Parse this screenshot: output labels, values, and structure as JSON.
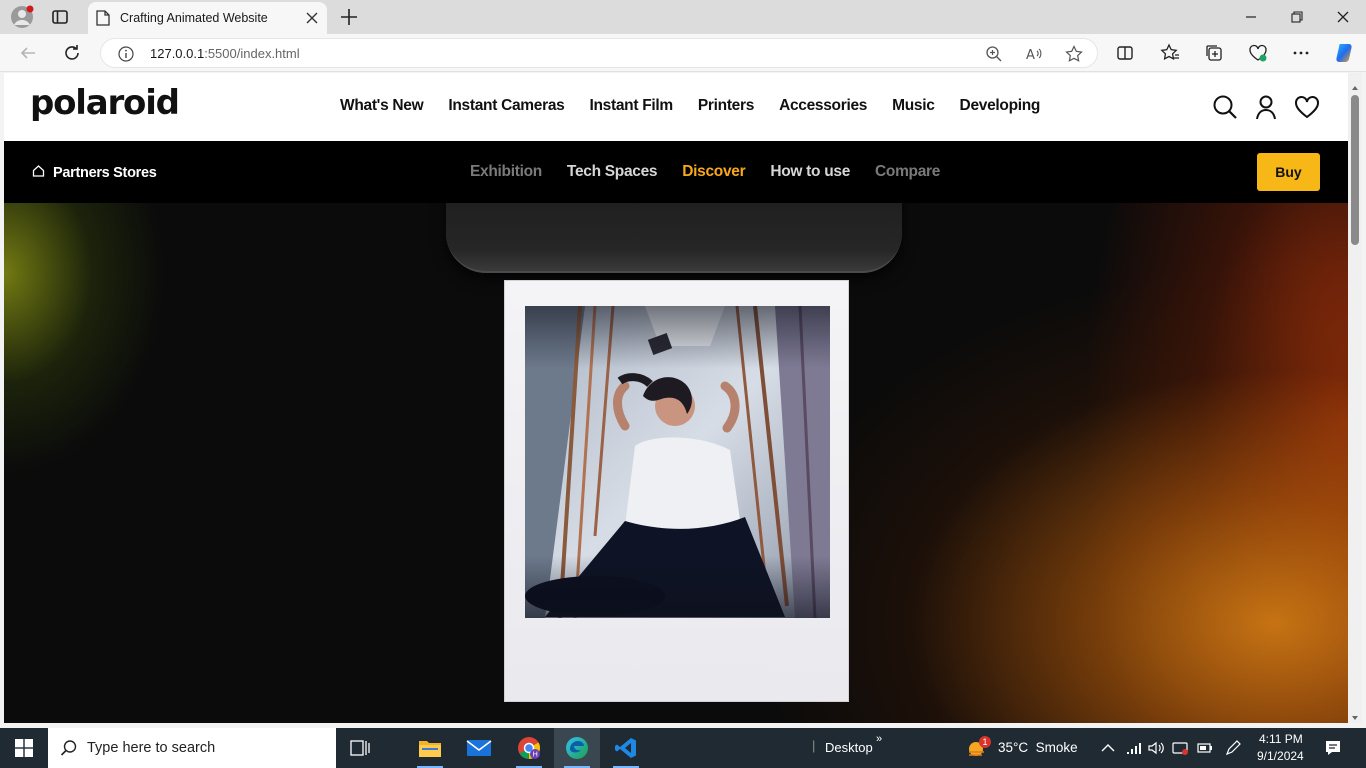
{
  "browser": {
    "tab_title": "Crafting Animated Website",
    "url_host": "127.0.0.1",
    "url_path": ":5500/index.html"
  },
  "site": {
    "logo": "polaroid",
    "main_nav": [
      "What's New",
      "Instant Cameras",
      "Instant Film",
      "Printers",
      "Accessories",
      "Music",
      "Developing"
    ],
    "partners_label": "Partners Stores",
    "sub_nav": [
      {
        "label": "Exhibition",
        "color": "#7a7a7a"
      },
      {
        "label": "Tech Spaces",
        "color": "#d6d6d6"
      },
      {
        "label": "Discover",
        "color": "#f7a81b"
      },
      {
        "label": "How to use",
        "color": "#d6d6d6"
      },
      {
        "label": "Compare",
        "color": "#7a7a7a"
      }
    ],
    "buy_label": "Buy",
    "accent_color": "#f7b817"
  },
  "taskbar": {
    "search_placeholder": "Type here to search",
    "desktop_label": "Desktop",
    "weather_badge": "1",
    "weather": "35°C  Smoke",
    "time": "4:11 PM",
    "date": "9/1/2024"
  }
}
